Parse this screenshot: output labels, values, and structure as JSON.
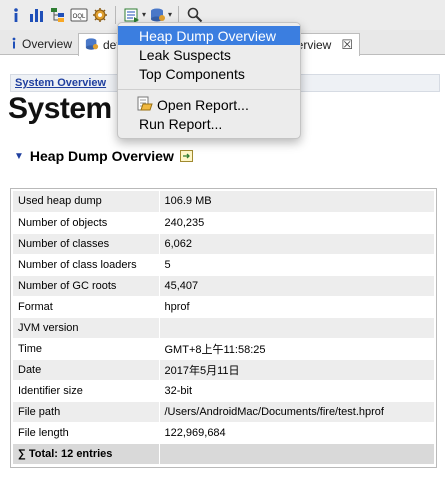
{
  "toolbar": {
    "buttons": [
      {
        "name": "info-icon"
      },
      {
        "name": "histogram-icon"
      },
      {
        "name": "dominator-tree-icon"
      },
      {
        "name": "oql-icon",
        "label": "OQL"
      },
      {
        "name": "thread-gear-icon"
      },
      {
        "name": "reports-icon"
      },
      {
        "name": "query-browser-icon"
      },
      {
        "name": "search-icon"
      }
    ]
  },
  "tabs": [
    {
      "label": "Overview"
    },
    {
      "label_left": "def",
      "label_right": "verview"
    }
  ],
  "breadcrumb": {
    "label": "System Overview"
  },
  "page": {
    "title": "System",
    "section_title": "Heap Dump Overview"
  },
  "table": {
    "rows": [
      {
        "key": "Used heap dump",
        "value": "106.9 MB"
      },
      {
        "key": "Number of objects",
        "value": "240,235"
      },
      {
        "key": "Number of classes",
        "value": "6,062"
      },
      {
        "key": "Number of class loaders",
        "value": "5"
      },
      {
        "key": "Number of GC roots",
        "value": "45,407"
      },
      {
        "key": "Format",
        "value": "hprof"
      },
      {
        "key": "JVM version",
        "value": ""
      },
      {
        "key": "Time",
        "value": "GMT+8上午11:58:25"
      },
      {
        "key": "Date",
        "value": "2017年5月11日"
      },
      {
        "key": "Identifier size",
        "value": "32-bit"
      },
      {
        "key": "File path",
        "value": "/Users/AndroidMac/Documents/fire/test.hprof"
      },
      {
        "key": "File length",
        "value": "122,969,684"
      }
    ],
    "total_symbol": "∑",
    "total_label": "Total: 12 entries"
  },
  "menu": {
    "items": [
      {
        "label": "Heap Dump Overview",
        "selected": true
      },
      {
        "label": "Leak Suspects"
      },
      {
        "label": "Top Components"
      }
    ],
    "items2": [
      {
        "label": "Open Report...",
        "icon": "open-report-icon"
      },
      {
        "label": "Run Report..."
      }
    ]
  },
  "colors": {
    "menu_highlight": "#3b7ee0",
    "link": "#1f3f9f",
    "row_stripe": "#ededed",
    "total_row": "#d9d9d9"
  }
}
